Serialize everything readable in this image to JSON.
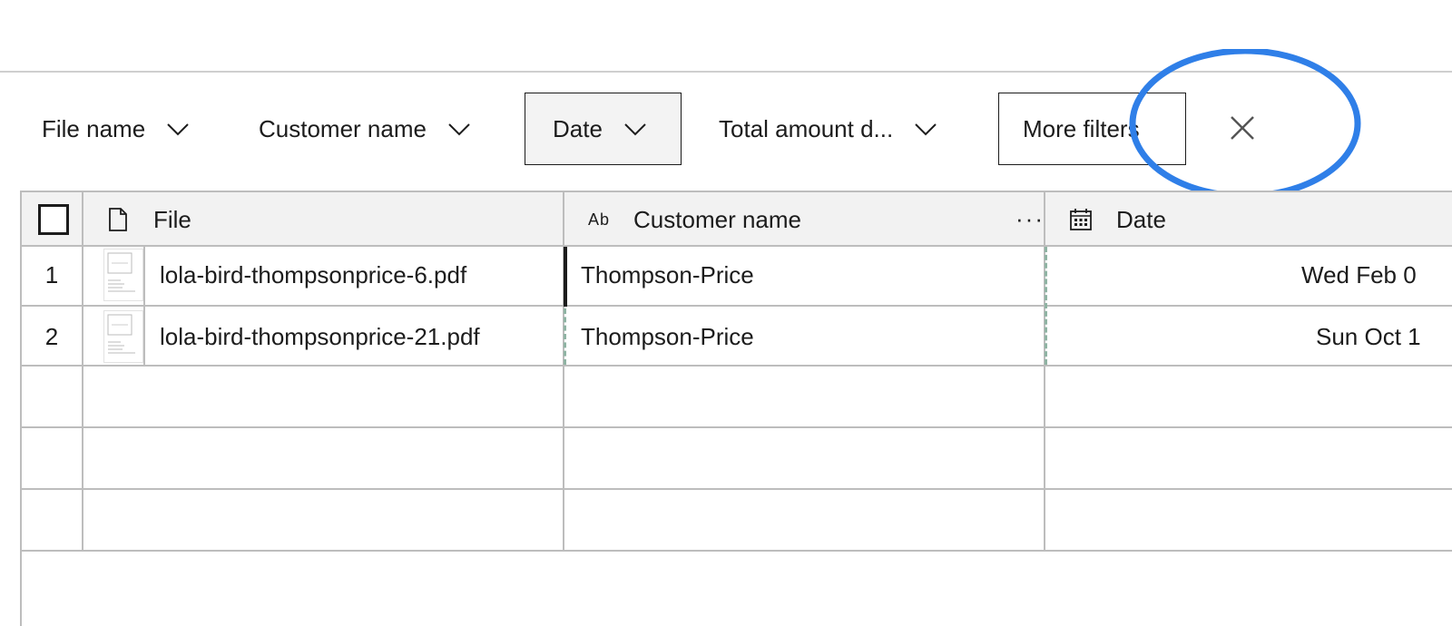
{
  "filters": {
    "file_name": "File name",
    "customer_name": "Customer name",
    "date": "Date",
    "total_amount": "Total amount d...",
    "more": "More filters"
  },
  "table": {
    "headers": {
      "file": "File",
      "customer_type_glyph": "Ab",
      "customer_name": "Customer name",
      "more": "···",
      "date": "Date"
    },
    "rows": [
      {
        "index": "1",
        "file": "lola-bird-thompsonprice-6.pdf",
        "customer": "Thompson-Price",
        "date": "Wed Feb 0"
      },
      {
        "index": "2",
        "file": "lola-bird-thompsonprice-21.pdf",
        "customer": "Thompson-Price",
        "date": "Sun Oct 1"
      }
    ]
  },
  "colors": {
    "highlight": "#2f7fe8",
    "selected_border": "#1c1c1c",
    "dashed": "#8fb3a3",
    "header_bg": "#f2f2f2"
  }
}
